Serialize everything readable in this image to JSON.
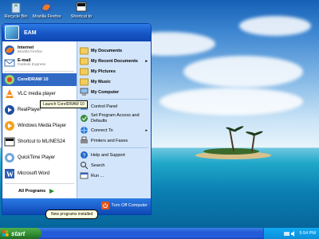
{
  "desktop": {
    "icons": [
      {
        "label": "Recycle Bin",
        "icon": "recycle-bin-icon"
      },
      {
        "label": "Mozilla Firefox",
        "icon": "firefox-icon"
      },
      {
        "label": "Shortcut to",
        "icon": "shortcut-icon"
      }
    ]
  },
  "start_menu": {
    "user": "EAM",
    "pinned": [
      {
        "title": "Internet",
        "subtitle": "Mozilla Firefox",
        "icon": "firefox-icon"
      },
      {
        "title": "E-mail",
        "subtitle": "Outlook Express",
        "icon": "outlook-express-icon"
      }
    ],
    "recent": [
      {
        "label": "CorelDRAW 10",
        "icon": "coreldraw-icon",
        "selected": true
      },
      {
        "label": "VLC media player",
        "icon": "vlc-icon"
      },
      {
        "label": "RealPlayer",
        "icon": "realplayer-icon"
      },
      {
        "label": "Windows Media Player",
        "icon": "windows-media-player-icon"
      },
      {
        "label": "Shortcut to MLINES24",
        "icon": "shortcut-icon"
      },
      {
        "label": "QuickTime Player",
        "icon": "quicktime-icon"
      },
      {
        "label": "Microsoft Word",
        "icon": "word-icon"
      }
    ],
    "all_programs": "All Programs",
    "right": [
      {
        "label": "My Documents",
        "bold": true,
        "icon": "folder-icon"
      },
      {
        "label": "My Recent Documents",
        "bold": true,
        "icon": "folder-icon",
        "arrow": "▸"
      },
      {
        "label": "My Pictures",
        "bold": true,
        "icon": "folder-icon"
      },
      {
        "label": "My Music",
        "bold": true,
        "icon": "folder-icon"
      },
      {
        "label": "My Computer",
        "bold": true,
        "icon": "computer-icon"
      },
      {
        "label": "Control Panel",
        "icon": "control-panel-icon"
      },
      {
        "label": "Set Program Access and Defaults",
        "icon": "program-access-icon"
      },
      {
        "label": "Connect To",
        "icon": "network-icon",
        "arrow": "▸"
      },
      {
        "label": "Printers and Faxes",
        "icon": "printer-icon"
      },
      {
        "label": "Help and Support",
        "icon": "help-icon"
      },
      {
        "label": "Search",
        "icon": "search-icon"
      },
      {
        "label": "Run ...",
        "icon": "run-icon"
      }
    ],
    "turn_off": "Turn Off Computer"
  },
  "tooltip": "Launch CorelDRAW 10",
  "balloon": "New programs installed",
  "taskbar": {
    "start_label": "start",
    "clock": "5:54 PM"
  },
  "colors": {
    "start_button": "#3c9a3c",
    "taskbar": "#245dda",
    "highlight": "#316ac5"
  }
}
